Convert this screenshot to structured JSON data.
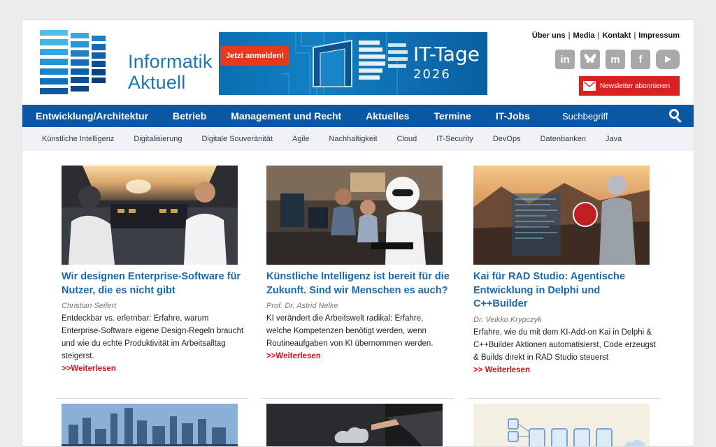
{
  "header": {
    "logo_line1": "Informatik",
    "logo_line2": "Aktuell",
    "banner": {
      "cta": "Jetzt anmelden!",
      "title": "IT-Tage",
      "year": "2026"
    },
    "top_links": [
      "Über uns",
      "Media",
      "Kontakt",
      "Impressum"
    ],
    "social_icons": [
      "linkedin-icon",
      "bluesky-icon",
      "mastodon-icon",
      "facebook-icon",
      "youtube-icon"
    ],
    "newsletter_label": "Newsletter abonnieren"
  },
  "main_nav": {
    "items": [
      "Entwicklung/Architektur",
      "Betrieb",
      "Management und Recht",
      "Aktuelles",
      "Termine",
      "IT-Jobs"
    ],
    "search_placeholder": "Suchbegriff"
  },
  "sub_nav": {
    "items": [
      "Künstliche Intelligenz",
      "Digitalisierung",
      "Digitale Souveränität",
      "Agile",
      "Nachhaltigkeit",
      "Cloud",
      "IT-Security",
      "DevOps",
      "Datenbanken",
      "Java"
    ]
  },
  "articles": [
    {
      "title": "Wir designen Enterprise-Software für Nutzer, die es nicht gibt",
      "author": "Christian Seifert",
      "teaser": "Entdeckbar vs. erlernbar: Erfahre, warum Enterprise-Software eigene Design-Regeln braucht und wie du echte Produktivität im Arbeitsalltag steigerst.",
      "more": ">>Weiterlesen"
    },
    {
      "title": "Künstliche Intelligenz ist bereit für die Zukunft. Sind wir Menschen es auch?",
      "author": "Prof. Dr. Astrid Nelke",
      "teaser": "KI verändert die Arbeitswelt radikal: Erfahre, welche Kompetenzen benötigt werden, wenn Routineaufgaben von KI übernommen werden.",
      "more": ">>Weiterlesen"
    },
    {
      "title": "Kai für RAD Studio: Agentische Entwicklung in Delphi und C++Builder",
      "author": "Dr. Veikko Krypczyk",
      "teaser": "Erfahre, wie du mit dem KI-Add-on Kai in Delphi & C++Builder Aktionen automatisierst, Code erzeugst & Builds direkt in RAD Studio steuerst",
      "more": ">> Weiterlesen"
    }
  ],
  "colors": {
    "brand_blue": "#0a57a3",
    "link_blue": "#1c68a8",
    "accent_red": "#d0141a"
  }
}
